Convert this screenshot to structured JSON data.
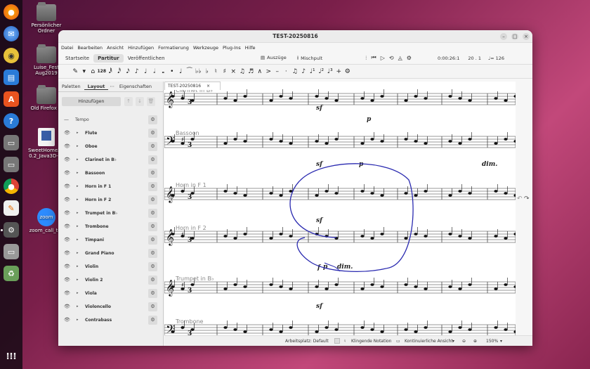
{
  "desktop": {
    "icons": [
      {
        "label": "Persönlicher Ordner"
      },
      {
        "label": "Luise_Fest Aug2019"
      },
      {
        "label": "Old Firefox D"
      },
      {
        "label": "SweetHome3D 0.2_Java3D-1_"
      },
      {
        "label": "zoom_call_tes"
      }
    ],
    "zoom_logo_text": "zoom"
  },
  "window": {
    "title": "TEST-20250816",
    "minimize": "–",
    "maximize": "□",
    "close": "×"
  },
  "menu": [
    "Datei",
    "Bearbeiten",
    "Ansicht",
    "Hinzufügen",
    "Formatierung",
    "Werkzeuge",
    "Plug-Ins",
    "Hilfe"
  ],
  "tabs": [
    "Startseite",
    "Partitur",
    "Veröffentlichen"
  ],
  "active_tab": "Partitur",
  "toolbar": {
    "auszuege": "Auszüge",
    "mischpult": "Mischpult",
    "time": "0:00:26:1",
    "position": "20 . 1",
    "tempo": "♩= 126"
  },
  "note_input": {
    "duration_number": "128"
  },
  "panel": {
    "tabs": [
      "Paletten",
      "Layout",
      "Eigenschaften"
    ],
    "active_tab": "Layout",
    "add_button": "Hinzufügen",
    "tempo_label": "Tempo",
    "instruments": [
      "Flute",
      "Oboe",
      "Clarinet in B♭",
      "Bassoon",
      "Horn in F 1",
      "Horn in F 2",
      "Trumpet in B♭",
      "Trombone",
      "Timpani",
      "Grand Piano",
      "Violin",
      "Violin 2",
      "Viola",
      "Violoncello",
      "Contrabass"
    ]
  },
  "document_tab": "TEST-20250816",
  "score": {
    "staff_labels": [
      "Clarinet in B♭",
      "Bassoon",
      "Horn in F 1",
      "Horn in F 2",
      "Trumpet in B♭",
      "Trombone"
    ],
    "dynamics": [
      "sf",
      "p",
      "sf",
      "p",
      "dim.",
      "sf",
      "f",
      "p",
      "dim.",
      "sf"
    ],
    "annotation_color": "#2a2ab0"
  },
  "status": {
    "workspace": "Arbeitsplatz: Default",
    "playback": "Klingende Notation",
    "view": "Kontinuierliche Ansicht",
    "zoom": "150%"
  }
}
